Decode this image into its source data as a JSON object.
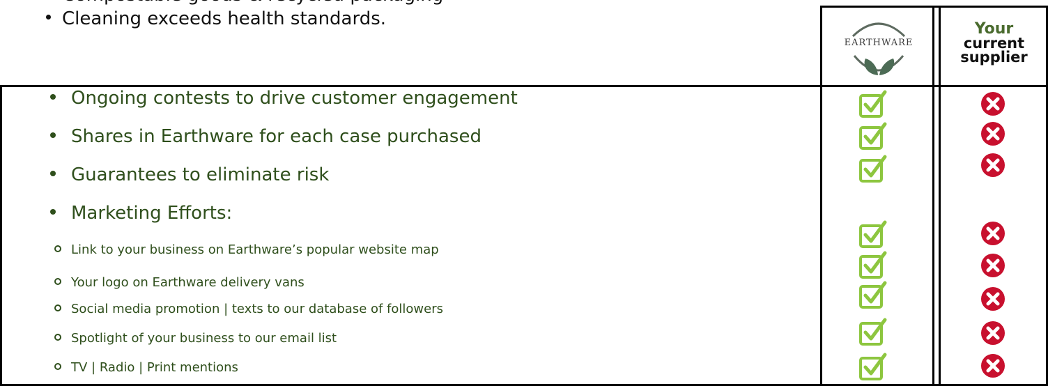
{
  "intro": {
    "cutoff_text": "• Compostable goods & recycled packaging",
    "cleaning": "Cleaning exceeds health standards."
  },
  "header": {
    "brand": "EARTHWARE",
    "supplier_line1": "Your",
    "supplier_line2": "current",
    "supplier_line3": "supplier"
  },
  "features": [
    {
      "label": "Ongoing contests to drive customer engagement"
    },
    {
      "label": "Shares in Earthware for each case purchased"
    },
    {
      "label": "Guarantees to eliminate risk"
    },
    {
      "label": "Marketing Efforts:"
    }
  ],
  "marketing": [
    {
      "label": "Link to your business on Earthware’s popular website map"
    },
    {
      "label": "Your logo on Earthware delivery vans"
    },
    {
      "label": "Social media promotion | texts to our database of followers"
    },
    {
      "label": "Spotlight of your business to our email list"
    },
    {
      "label": "TV | Radio | Print mentions"
    }
  ],
  "colors": {
    "check": "#8dc63f",
    "x": "#c8102e",
    "feature_text": "#2f4f1c"
  },
  "icons": {
    "check": "checkbox-check-icon",
    "x": "red-x-icon"
  }
}
